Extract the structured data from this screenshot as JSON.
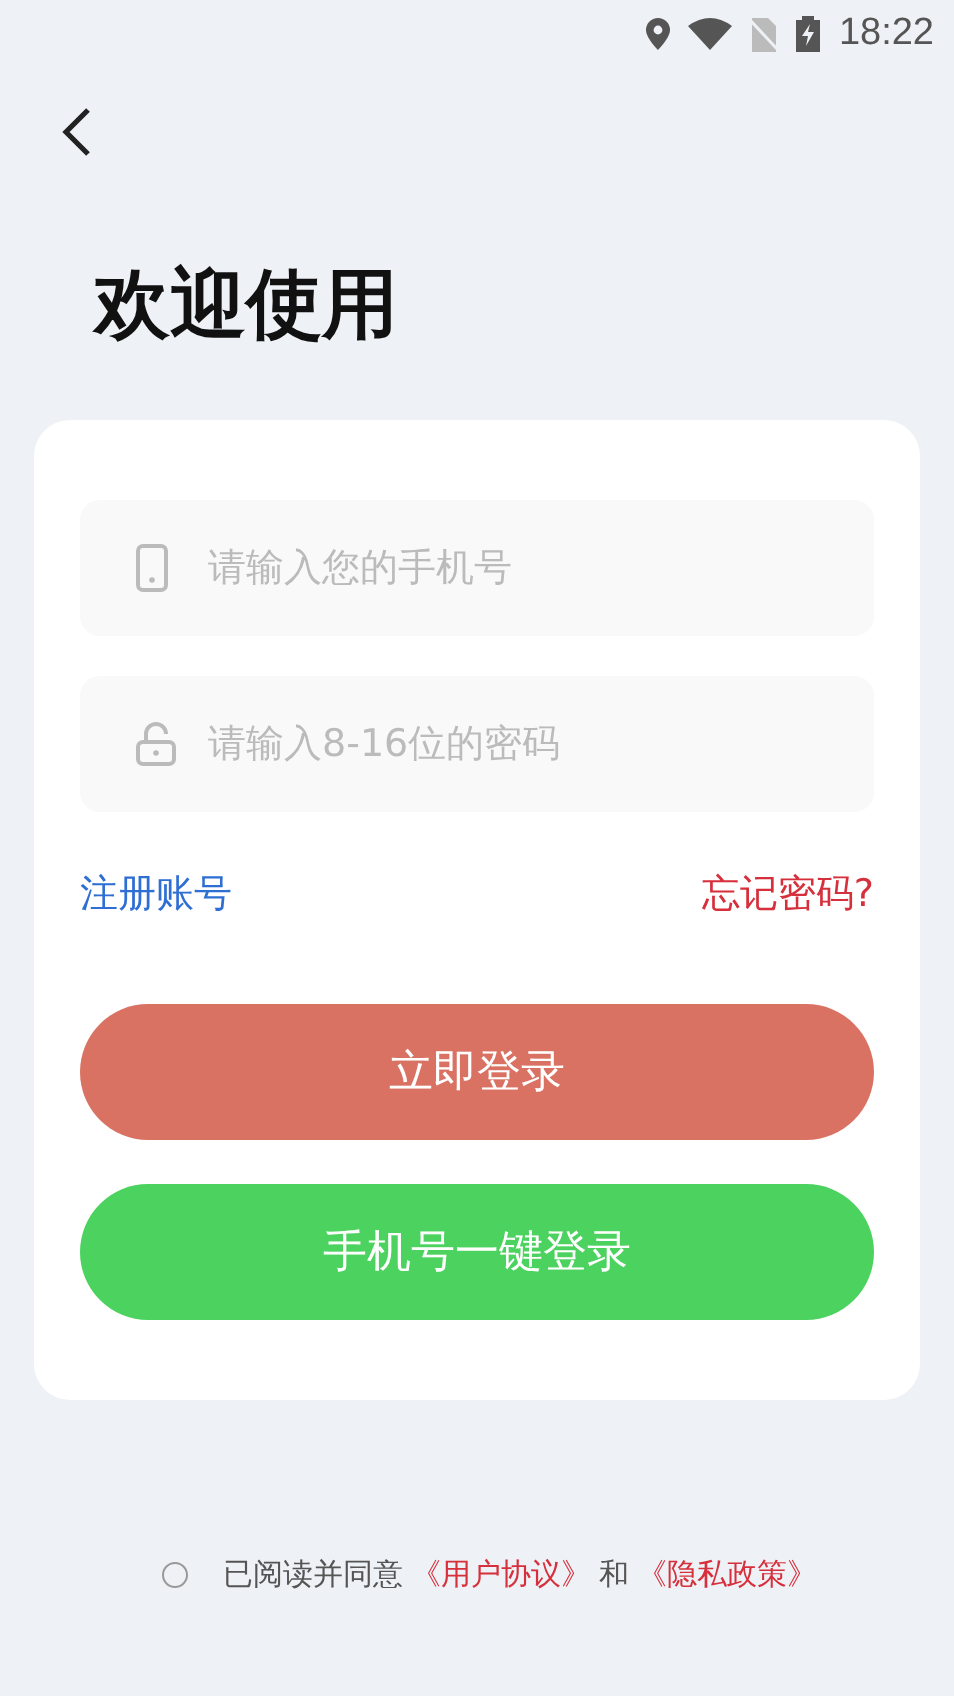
{
  "status_bar": {
    "time": "18:22"
  },
  "title": "欢迎使用",
  "fields": [
    {
      "kind": "phone",
      "placeholder": "请输入您的手机号"
    },
    {
      "kind": "password",
      "placeholder": "请输入8-16位的密码"
    }
  ],
  "links": {
    "register": "注册账号",
    "forgot": "忘记密码?"
  },
  "buttons": [
    {
      "kind": "login",
      "label": "立即登录"
    },
    {
      "kind": "quick",
      "label": "手机号一键登录"
    }
  ],
  "agreement": {
    "checked": false,
    "text": "已阅读并同意",
    "user_agreement": "《用户协议》",
    "joiner": "和",
    "privacy_policy": "《隐私政策》"
  }
}
